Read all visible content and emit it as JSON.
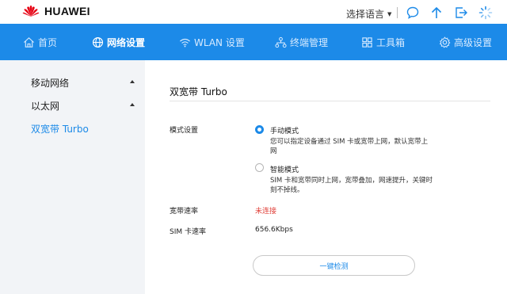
{
  "header": {
    "brand": "HUAWEI",
    "language_label": "选择语言"
  },
  "nav": {
    "items": [
      {
        "label": "首页",
        "icon": "home-icon"
      },
      {
        "label": "网络设置",
        "icon": "globe-icon",
        "active": true
      },
      {
        "label": "WLAN 设置",
        "icon": "wifi-icon"
      },
      {
        "label": "终端管理",
        "icon": "devices-icon"
      },
      {
        "label": "工具箱",
        "icon": "toolbox-icon"
      },
      {
        "label": "高级设置",
        "icon": "gear-icon"
      }
    ]
  },
  "sidebar": {
    "items": [
      {
        "label": "移动网络",
        "expandable": true
      },
      {
        "label": "以太网",
        "expandable": true
      },
      {
        "label": "双宽带 Turbo",
        "active": true
      }
    ]
  },
  "main": {
    "title": "双宽带 Turbo",
    "mode_label": "模式设置",
    "options": [
      {
        "title": "手动模式",
        "desc": "您可以指定设备通过 SIM 卡或宽带上网，默认宽带上网",
        "selected": true
      },
      {
        "title": "智能模式",
        "desc": "SIM 卡和宽带同时上网，宽带叠加，网速提升，关键时刻不掉线。",
        "selected": false
      }
    ],
    "broadband_speed_label": "宽带速率",
    "broadband_speed_value": "未连接",
    "sim_speed_label": "SIM 卡速率",
    "sim_speed_value": "656.6Kbps",
    "check_button": "一键检测"
  },
  "colors": {
    "accent": "#1c8ae8",
    "error": "#e0413a",
    "sidebar_bg": "#f2f4f7"
  }
}
